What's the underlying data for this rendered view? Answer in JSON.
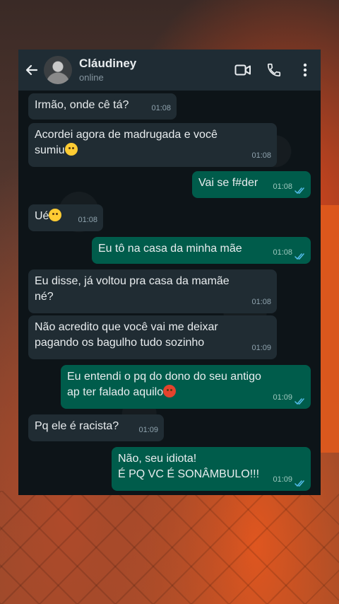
{
  "header": {
    "contact_name": "Cláudiney",
    "status": "online"
  },
  "icons": {
    "back": "arrow-left-icon",
    "avatar": "avatar",
    "video": "video-camera-icon",
    "call": "phone-icon",
    "menu": "more-vertical-icon"
  },
  "colors": {
    "header_bg": "#1f2c34",
    "incoming_bubble": "#202c33",
    "outgoing_bubble": "#005c4b",
    "read_ticks": "#53bdeb"
  },
  "messages": [
    {
      "dir": "in",
      "text": "Irmão, onde cê tá?",
      "time": "01:08"
    },
    {
      "dir": "in",
      "text": "Acordei agora de madrugada e você\nsumiu",
      "emoji": "raised-eyebrow-emoji",
      "time": "01:08"
    },
    {
      "dir": "out",
      "text": "Vai se f#der",
      "time": "01:08",
      "read": true
    },
    {
      "dir": "in",
      "text": "Ué",
      "emoji": "flushed-face-emoji",
      "time": "01:08"
    },
    {
      "dir": "out",
      "text": "Eu tô na casa da minha mãe",
      "time": "01:08",
      "read": true
    },
    {
      "dir": "in",
      "text": "Eu disse, já voltou pra casa da mamãe\nné?",
      "time": "01:08"
    },
    {
      "dir": "in",
      "text": "Não acredito que você vai me deixar\npagando os bagulho tudo sozinho",
      "time": "01:09"
    },
    {
      "dir": "out",
      "text": "Eu entendi o pq do dono do seu antigo\nap ter falado aquilo",
      "emoji": "angry-face-emoji",
      "time": "01:09",
      "read": true
    },
    {
      "dir": "in",
      "text": "Pq ele é racista?",
      "time": "01:09"
    },
    {
      "dir": "out",
      "text": "Não, seu idiota!\nÉ PQ VC É SONÂMBULO!!!",
      "time": "01:09",
      "read": true
    }
  ]
}
